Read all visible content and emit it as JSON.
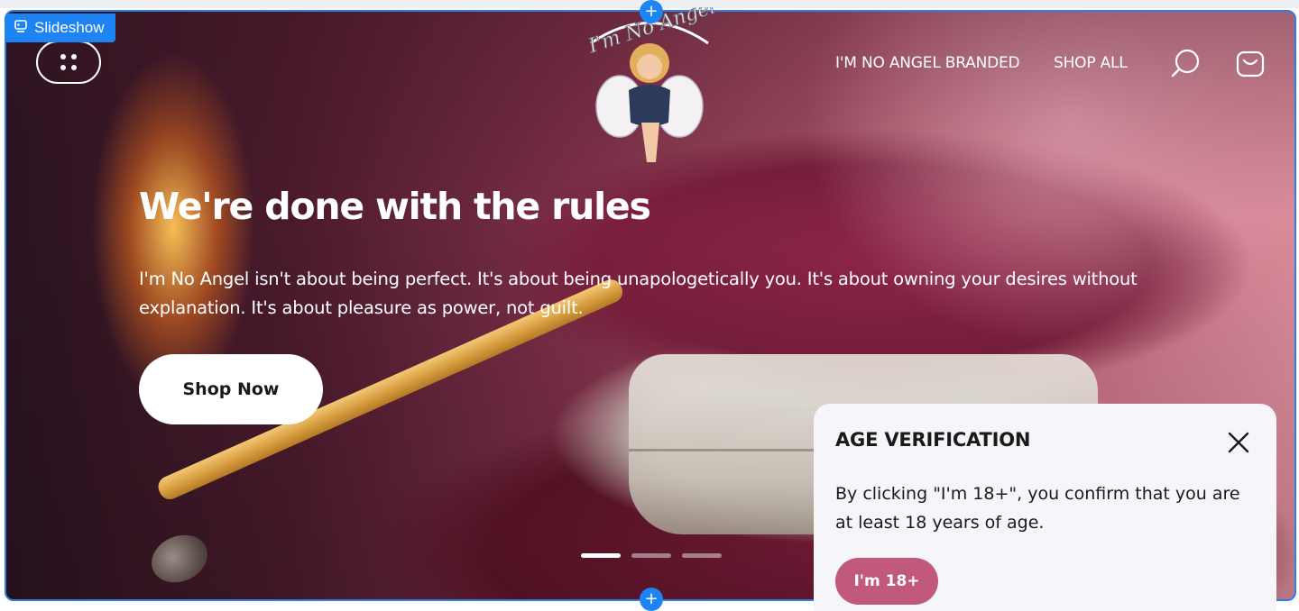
{
  "editor": {
    "badge_label": "Slideshow",
    "badge_icon": "slideshow-icon",
    "add_icon": "+",
    "accent_color": "#1f84f3"
  },
  "header": {
    "menu_icon": "grid-dots-icon",
    "logo_text": "I'm No Angel",
    "nav": [
      {
        "label": "I'M NO ANGEL BRANDED"
      },
      {
        "label": "SHOP ALL"
      }
    ],
    "search_icon": "search-icon",
    "cart_icon": "shopping-bag-icon"
  },
  "slide": {
    "title": "We're done with the rules",
    "text": "I'm No Angel isn't about being perfect. It's about being unapologetically you. It's about owning your desires without explanation. It's about pleasure as power, not guilt.",
    "cta_label": "Shop Now",
    "slide_count": 3,
    "active_slide": 1
  },
  "age_verification": {
    "title": "AGE VERIFICATION",
    "text": "By clicking \"I'm 18+\", you confirm that you are at least 18 years of age.",
    "confirm_label": "I'm 18+",
    "close_icon": "close-icon",
    "button_color": "#c0597a"
  }
}
